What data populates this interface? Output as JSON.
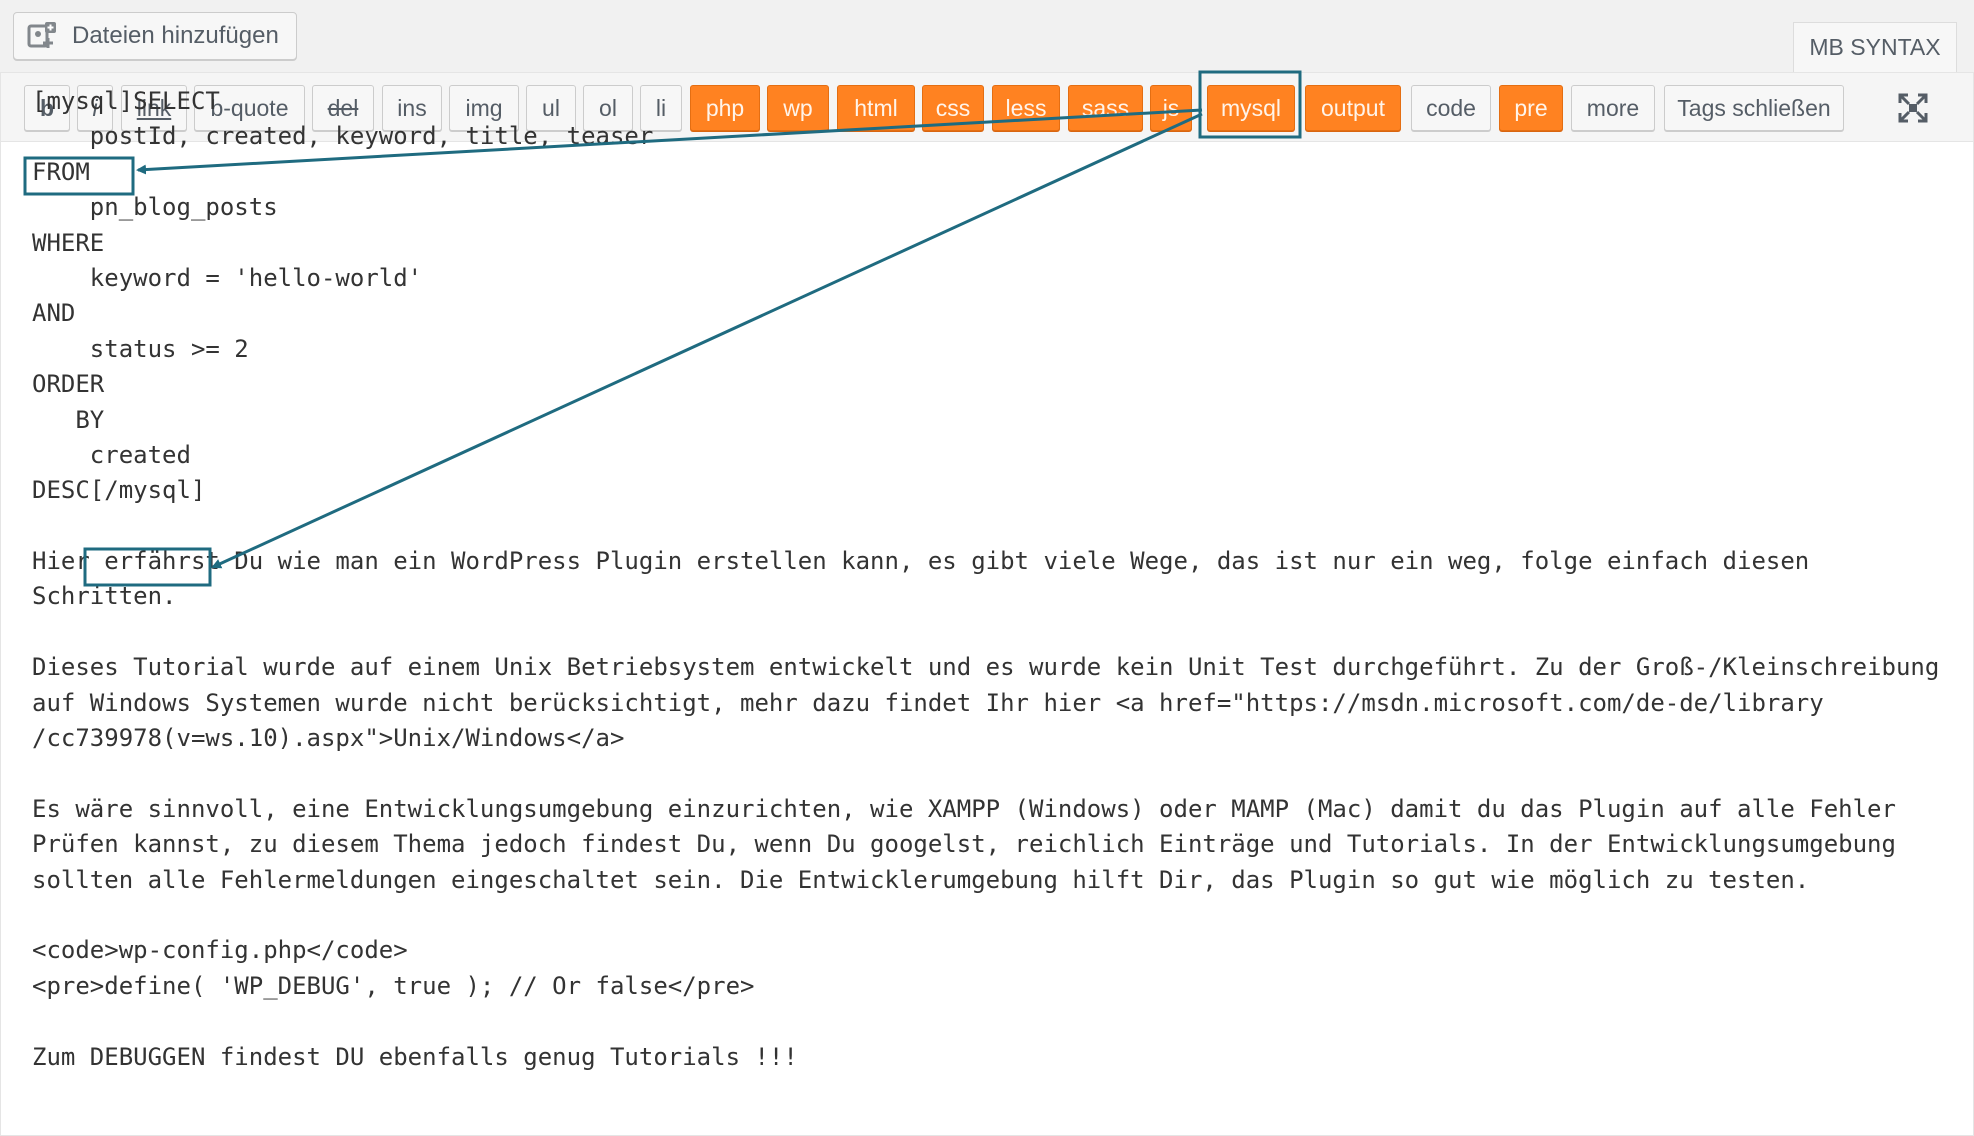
{
  "media_button": {
    "label": "Dateien hinzufügen",
    "icon": "media-add-icon"
  },
  "tabs": {
    "syntax": "MB SYNTAX"
  },
  "toolbar": {
    "buttons": [
      {
        "id": "b",
        "label": "b",
        "style": "normal"
      },
      {
        "id": "i",
        "label": "i",
        "style": "normal"
      },
      {
        "id": "link",
        "label": "link",
        "style": "normal"
      },
      {
        "id": "b-quote",
        "label": "b-quote",
        "style": "normal"
      },
      {
        "id": "del",
        "label": "del",
        "style": "normal"
      },
      {
        "id": "ins",
        "label": "ins",
        "style": "normal"
      },
      {
        "id": "img",
        "label": "img",
        "style": "normal"
      },
      {
        "id": "ul",
        "label": "ul",
        "style": "normal"
      },
      {
        "id": "ol",
        "label": "ol",
        "style": "normal"
      },
      {
        "id": "li",
        "label": "li",
        "style": "normal"
      },
      {
        "id": "php",
        "label": "php",
        "style": "orange"
      },
      {
        "id": "wp",
        "label": "wp",
        "style": "orange"
      },
      {
        "id": "html",
        "label": "html",
        "style": "orange"
      },
      {
        "id": "css",
        "label": "css",
        "style": "orange"
      },
      {
        "id": "less",
        "label": "less",
        "style": "orange"
      },
      {
        "id": "sass",
        "label": "sass",
        "style": "orange"
      },
      {
        "id": "js",
        "label": "js",
        "style": "orange"
      },
      {
        "id": "mysql",
        "label": "mysql",
        "style": "orange"
      },
      {
        "id": "output",
        "label": "output",
        "style": "orange"
      },
      {
        "id": "code",
        "label": "code",
        "style": "normal"
      },
      {
        "id": "pre",
        "label": "pre",
        "style": "orange"
      },
      {
        "id": "more",
        "label": "more",
        "style": "normal"
      },
      {
        "id": "close-tags",
        "label": "Tags schließen",
        "style": "normal"
      }
    ],
    "fullscreen_icon": "fullscreen-icon"
  },
  "editor": {
    "tag_open": "[mysql]",
    "tag_close": "[/mysql]",
    "sql_first": "SELECT",
    "sql_lines": [
      "    postId, created, keyword, title, teaser",
      "FROM",
      "    pn_blog_posts",
      "WHERE",
      "    keyword = 'hello-world'",
      "AND",
      "    status >= 2",
      "ORDER",
      "   BY",
      "    created"
    ],
    "sql_last": "DESC",
    "paragraphs": [
      "Hier erfährst Du wie man ein WordPress Plugin erstellen kann, es gibt viele Wege, das ist nur ein weg, folge einfach diesen",
      "Schritten.",
      "",
      "Dieses Tutorial wurde auf einem Unix Betriebsystem entwickelt und es wurde kein Unit Test durchgeführt. Zu der Groß-/Kleinschreibung",
      "auf Windows Systemen wurde nicht berücksichtigt, mehr dazu findet Ihr hier <a href=\"https://msdn.microsoft.com/de-de/library",
      "/cc739978(v=ws.10).aspx\">Unix/Windows</a>",
      "",
      "Es wäre sinnvoll, eine Entwicklungsumgebung einzurichten, wie XAMPP (Windows) oder MAMP (Mac) damit du das Plugin auf alle Fehler",
      "Prüfen kannst, zu diesem Thema jedoch findest Du, wenn Du googelst, reichlich Einträge und Tutorials. In der Entwicklungsumgebung",
      "sollten alle Fehlermeldungen eingeschaltet sein. Die Entwicklerumgebung hilft Dir, das Plugin so gut wie möglich zu testen.",
      "",
      "<code>wp-config.php</code>",
      "<pre>define( 'WP_DEBUG', true ); // Or false</pre>",
      "",
      "Zum DEBUGGEN findest DU ebenfalls genug Tutorials !!!"
    ]
  },
  "colors": {
    "orange_button": "#ff8221",
    "annotation": "#1f6b80"
  }
}
